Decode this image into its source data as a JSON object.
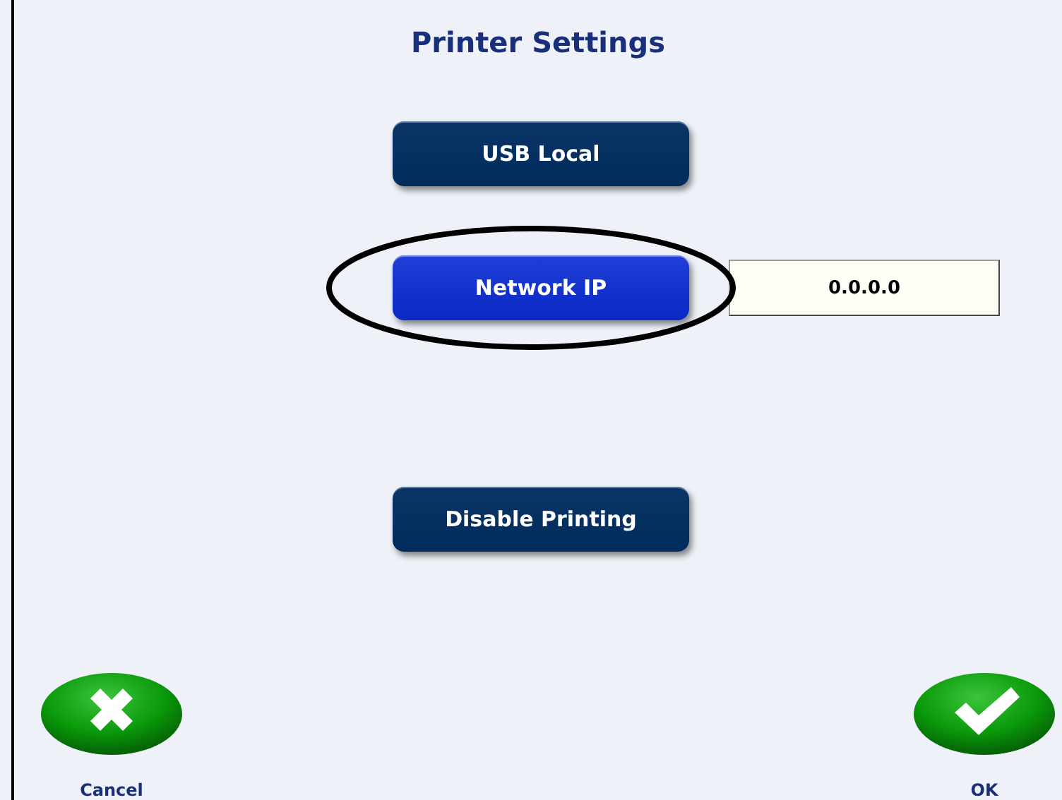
{
  "title": "Printer Settings",
  "options": [
    {
      "label": "USB Local",
      "selected": false,
      "circled": false
    },
    {
      "label": "Network IP",
      "selected": true,
      "circled": true,
      "field_value": "0.0.0.0"
    },
    {
      "label": "Disable Printing",
      "selected": false,
      "circled": false
    }
  ],
  "actions": [
    {
      "kind": "cancel",
      "label": "Cancel"
    },
    {
      "kind": "ok",
      "label": "OK"
    }
  ]
}
